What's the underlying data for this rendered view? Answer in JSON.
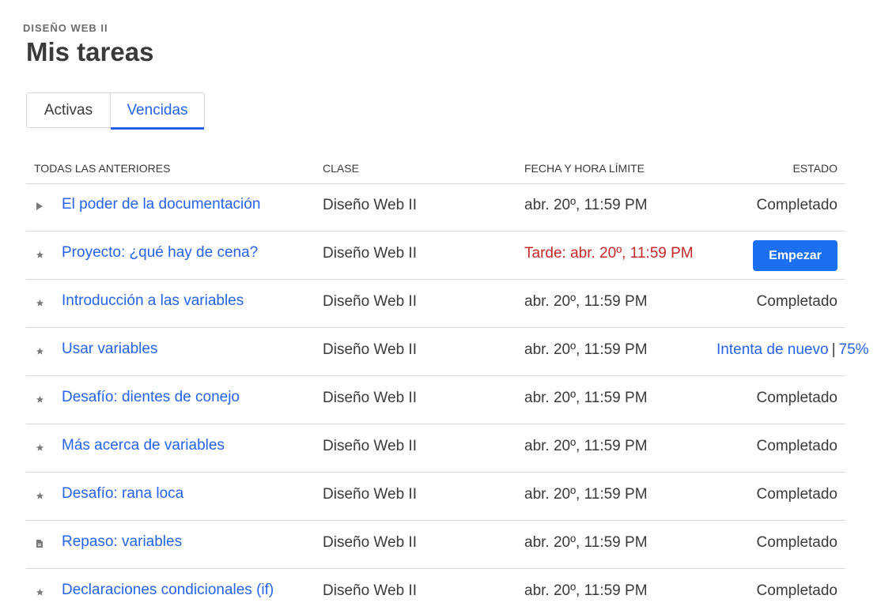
{
  "course": "DISEÑO WEB II",
  "title": "Mis tareas",
  "tabs": [
    {
      "label": "Activas",
      "active": false
    },
    {
      "label": "Vencidas",
      "active": true
    }
  ],
  "columns": {
    "all": "TODAS LAS ANTERIORES",
    "class": "CLASE",
    "date": "FECHA Y HORA LÍMITE",
    "status": "ESTADO"
  },
  "colors": {
    "link": "#2563eb",
    "late": "#c62828",
    "button": "#1d6ff2"
  },
  "rows": [
    {
      "icon": "play-icon",
      "title": "El poder de la documentación",
      "class": "Diseño Web II",
      "date": "abr. 20º, 11:59 PM",
      "status": "Completado"
    },
    {
      "icon": "star-icon",
      "title": "Proyecto: ¿qué hay de cena?",
      "class": "Diseño Web II",
      "date": "Tarde: abr. 20º, 11:59 PM",
      "status_button": "Empezar"
    },
    {
      "icon": "star-icon",
      "title": "Introducción a las variables",
      "class": "Diseño Web II",
      "date": "abr. 20º, 11:59 PM",
      "status": "Completado"
    },
    {
      "icon": "star-icon",
      "title": "Usar variables",
      "class": "Diseño Web II",
      "date": "abr. 20º, 11:59 PM",
      "retry_label": "Intenta de nuevo",
      "retry_separator": "|",
      "score": "75%"
    },
    {
      "icon": "star-icon",
      "title": "Desafío: dientes de conejo",
      "class": "Diseño Web II",
      "date": "abr. 20º, 11:59 PM",
      "status": "Completado"
    },
    {
      "icon": "star-icon",
      "title": "Más acerca de variables",
      "class": "Diseño Web II",
      "date": "abr. 20º, 11:59 PM",
      "status": "Completado"
    },
    {
      "icon": "star-icon",
      "title": "Desafío: rana loca",
      "class": "Diseño Web II",
      "date": "abr. 20º, 11:59 PM",
      "status": "Completado"
    },
    {
      "icon": "document-icon",
      "title": "Repaso: variables",
      "class": "Diseño Web II",
      "date": "abr. 20º, 11:59 PM",
      "status": "Completado"
    },
    {
      "icon": "star-icon",
      "title": "Declaraciones condicionales (if)",
      "class": "Diseño Web II",
      "date": "abr. 20º, 11:59 PM",
      "status": "Completado"
    }
  ]
}
